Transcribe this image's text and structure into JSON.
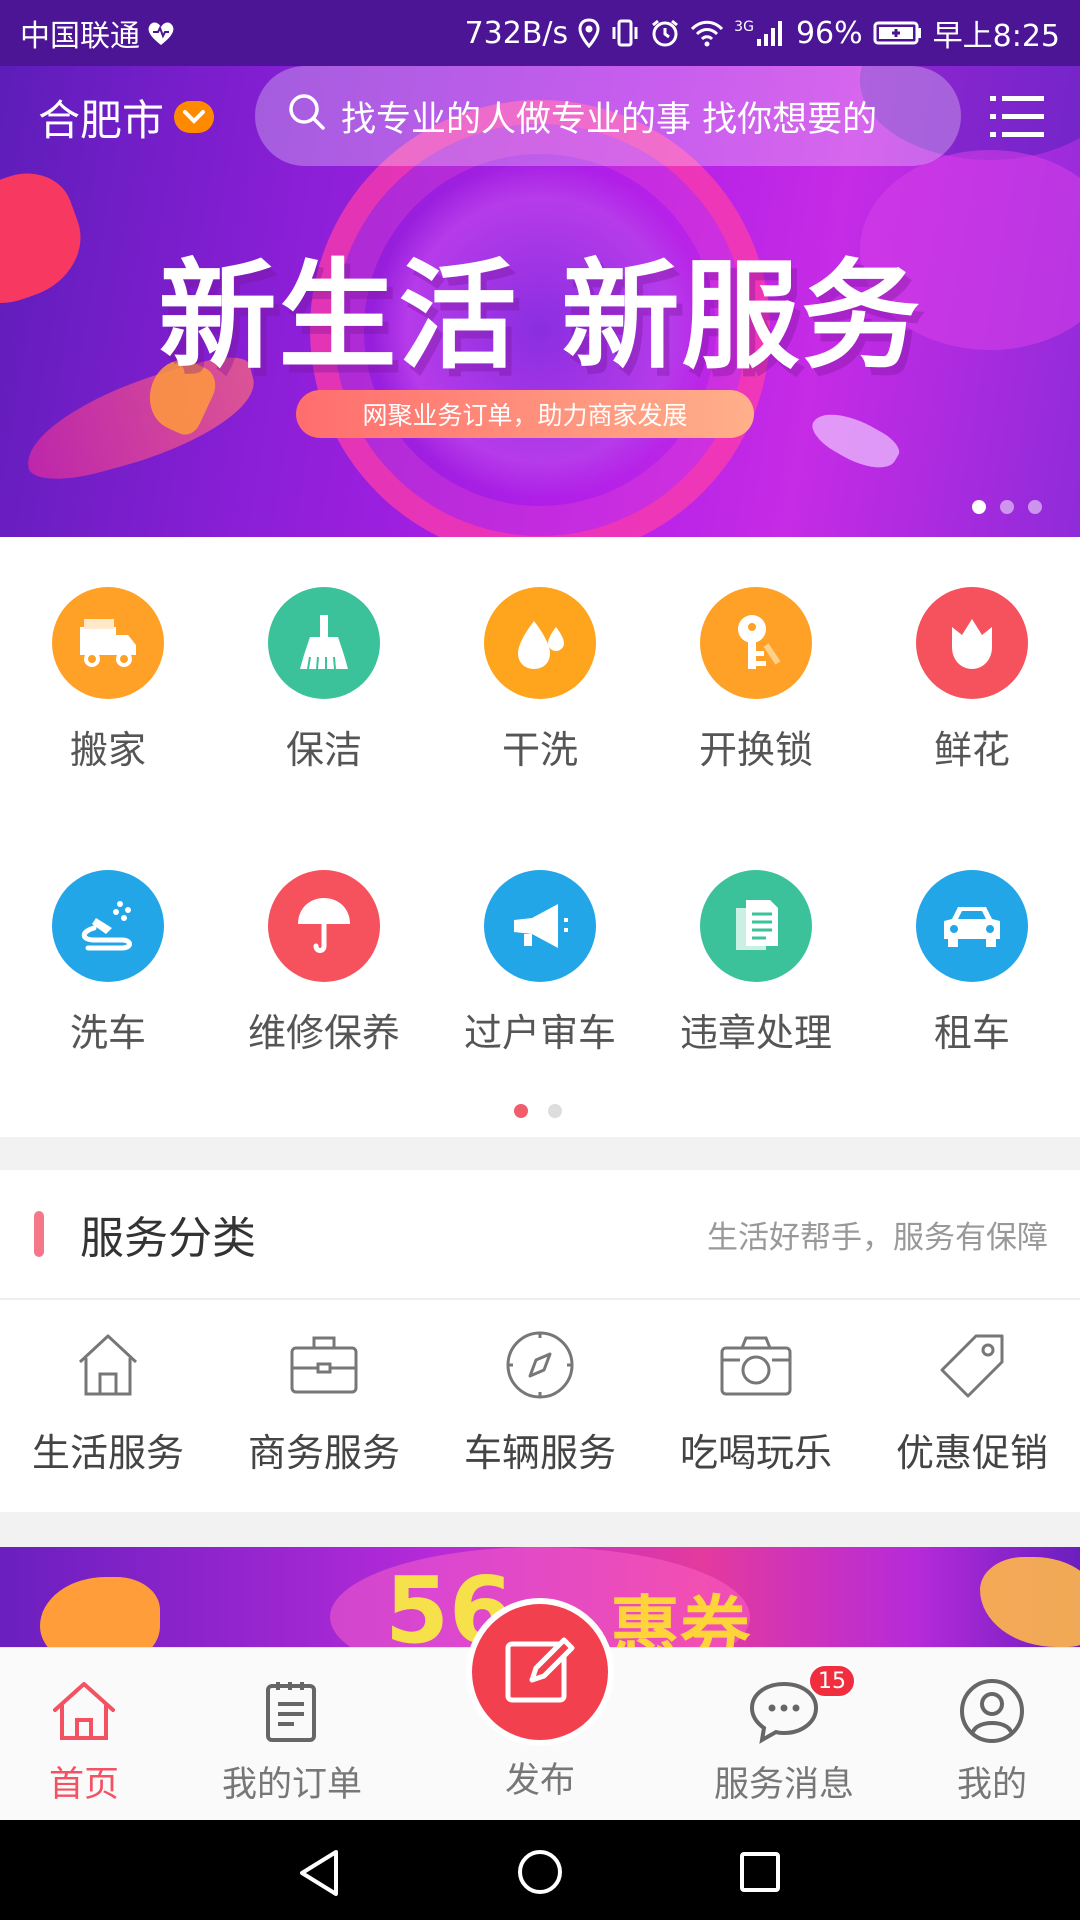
{
  "status_bar": {
    "carrier": "中国联通",
    "speed": "732B/s",
    "battery": "96%",
    "time": "早上8:25",
    "network_tag": "3G"
  },
  "header": {
    "city": "合肥市",
    "search_placeholder": "找专业的人做专业的事 找你想要的"
  },
  "banner": {
    "title": "新生活 新服务",
    "subtitle": "网聚业务订单，助力商家发展",
    "dots": 3,
    "active_dot": 0
  },
  "services": {
    "items": [
      {
        "label": "搬家",
        "icon": "truck-icon",
        "color": "#ffa126"
      },
      {
        "label": "保洁",
        "icon": "broom-icon",
        "color": "#3cc29a"
      },
      {
        "label": "干洗",
        "icon": "water-drop-icon",
        "color": "#ffa41d"
      },
      {
        "label": "开换锁",
        "icon": "key-icon",
        "color": "#ffa126"
      },
      {
        "label": "鲜花",
        "icon": "tulip-icon",
        "color": "#f5525e"
      },
      {
        "label": "洗车",
        "icon": "car-wash-icon",
        "color": "#22a6e8"
      },
      {
        "label": "维修保养",
        "icon": "umbrella-icon",
        "color": "#f5525e"
      },
      {
        "label": "过户审车",
        "icon": "megaphone-icon",
        "color": "#22a6e8"
      },
      {
        "label": "违章处理",
        "icon": "document-icon",
        "color": "#3cc29a"
      },
      {
        "label": "租车",
        "icon": "car-icon",
        "color": "#22a6e8"
      }
    ],
    "pages": 2,
    "active_page": 0
  },
  "category": {
    "title": "服务分类",
    "subtitle": "生活好帮手，服务有保障",
    "items": [
      {
        "label": "生活服务",
        "icon": "house-icon"
      },
      {
        "label": "商务服务",
        "icon": "briefcase-icon"
      },
      {
        "label": "车辆服务",
        "icon": "compass-icon"
      },
      {
        "label": "吃喝玩乐",
        "icon": "camera-icon"
      },
      {
        "label": "优惠促销",
        "icon": "tag-icon"
      }
    ]
  },
  "promo_banner": {
    "number": "56",
    "text": "惠券"
  },
  "tabbar": {
    "home": "首页",
    "orders": "我的订单",
    "publish": "发布",
    "messages": "服务消息",
    "messages_badge": "15",
    "mine": "我的"
  },
  "colors": {
    "accent": "#f25262",
    "banner_purple": "#9a22e0"
  }
}
